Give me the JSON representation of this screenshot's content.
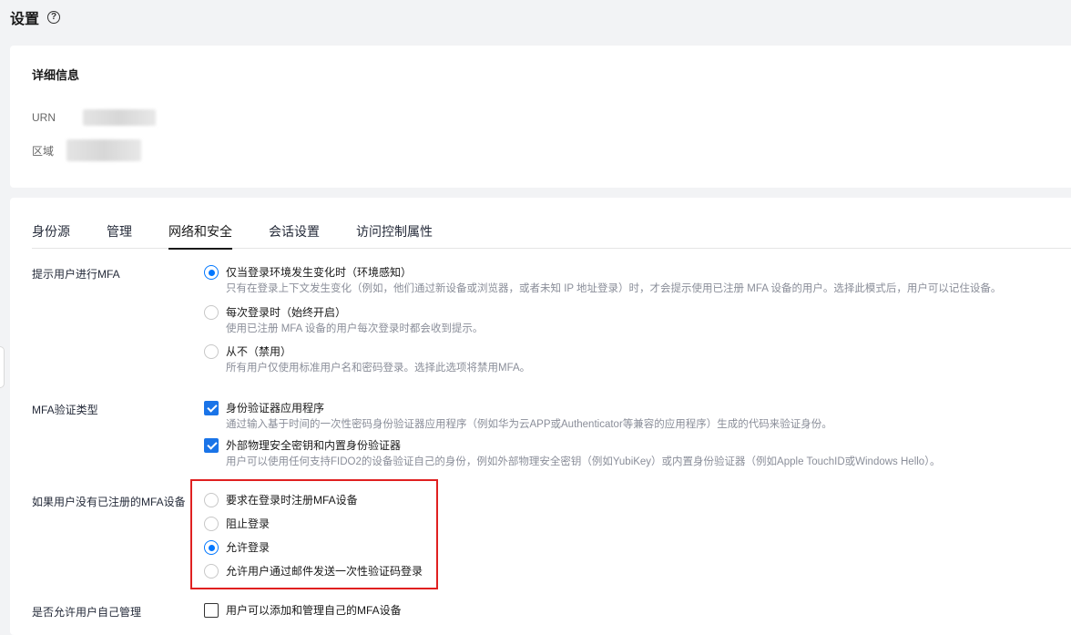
{
  "header": {
    "title": "设置",
    "help_icon": "help-circle-icon"
  },
  "details": {
    "title": "详细信息",
    "urn_label": "URN",
    "region_label": "区域"
  },
  "tabs": [
    {
      "label": "身份源",
      "active": false
    },
    {
      "label": "管理",
      "active": false
    },
    {
      "label": "网络和安全",
      "active": true
    },
    {
      "label": "会话设置",
      "active": false
    },
    {
      "label": "访问控制属性",
      "active": false
    }
  ],
  "mfa_prompt": {
    "label": "提示用户进行MFA",
    "options": [
      {
        "title": "仅当登录环境发生变化时（环境感知）",
        "desc": "只有在登录上下文发生变化（例如，他们通过新设备或浏览器，或者未知 IP 地址登录）时，才会提示使用已注册 MFA 设备的用户。选择此模式后，用户可以记住设备。",
        "checked": true
      },
      {
        "title": "每次登录时（始终开启）",
        "desc": "使用已注册 MFA 设备的用户每次登录时都会收到提示。",
        "checked": false
      },
      {
        "title": "从不（禁用）",
        "desc": "所有用户仅使用标准用户名和密码登录。选择此选项将禁用MFA。",
        "checked": false
      }
    ]
  },
  "mfa_type": {
    "label": "MFA验证类型",
    "options": [
      {
        "title": "身份验证器应用程序",
        "desc": "通过输入基于时间的一次性密码身份验证器应用程序（例如华为云APP或Authenticator等兼容的应用程序）生成的代码来验证身份。",
        "checked": true
      },
      {
        "title": "外部物理安全密钥和内置身份验证器",
        "desc": "用户可以使用任何支持FIDO2的设备验证自己的身份，例如外部物理安全密钥（例如YubiKey）或内置身份验证器（例如Apple TouchID或Windows Hello）。",
        "checked": true
      }
    ]
  },
  "no_mfa_device": {
    "label": "如果用户没有已注册的MFA设备",
    "options": [
      {
        "title": "要求在登录时注册MFA设备",
        "checked": false
      },
      {
        "title": "阻止登录",
        "checked": false
      },
      {
        "title": "允许登录",
        "checked": true
      },
      {
        "title": "允许用户通过邮件发送一次性验证码登录",
        "checked": false
      }
    ]
  },
  "self_manage": {
    "label": "是否允许用户自己管理",
    "option": {
      "title": "用户可以添加和管理自己的MFA设备",
      "checked": false
    }
  },
  "colors": {
    "accent": "#0077ff",
    "checkbox": "#1a74e8",
    "highlight": "#e02020"
  }
}
